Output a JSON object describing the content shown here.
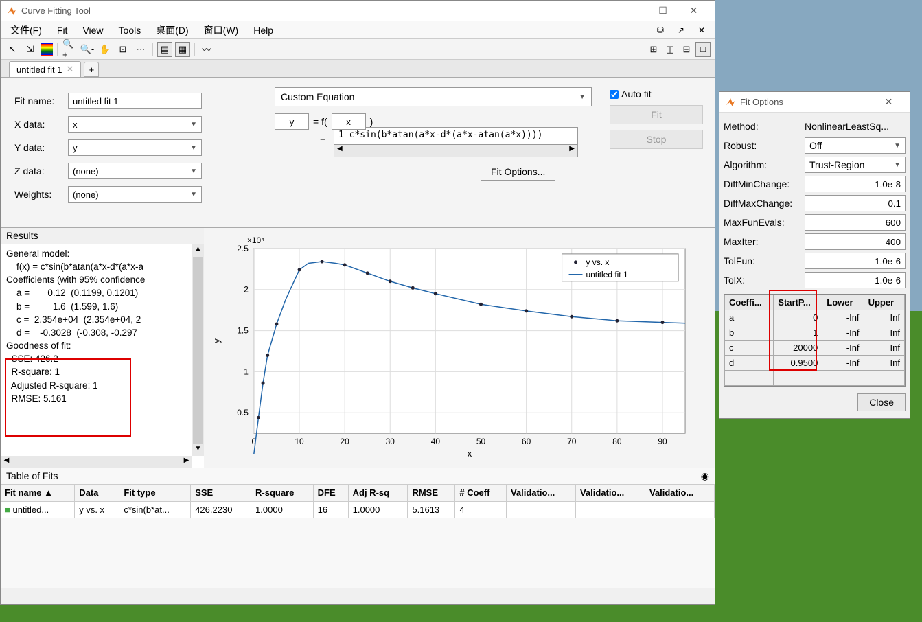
{
  "window": {
    "title": "Curve Fitting Tool"
  },
  "menu": {
    "file": "文件(F)",
    "fit": "Fit",
    "view": "View",
    "tools": "Tools",
    "desktop": "桌面(D)",
    "window": "窗口(W)",
    "help": "Help"
  },
  "tab": {
    "name": "untitled fit 1"
  },
  "config": {
    "fitname_label": "Fit name:",
    "fitname_value": "untitled fit 1",
    "xdata_label": "X data:",
    "xdata_value": "x",
    "ydata_label": "Y data:",
    "ydata_value": "y",
    "zdata_label": "Z data:",
    "zdata_value": "(none)",
    "weights_label": "Weights:",
    "weights_value": "(none)",
    "eqtype": "Custom Equation",
    "y_var": "y",
    "x_var": "x",
    "f_open": " = f( ",
    "f_close": " )",
    "eq_prefix": "=",
    "equation": "1 c*sin(b*atan(a*x-d*(a*x-atan(a*x))))",
    "fit_options_btn": "Fit Options...",
    "autofit": "Auto fit",
    "fit_btn": "Fit",
    "stop_btn": "Stop"
  },
  "results": {
    "header": "Results",
    "l1": "General model:",
    "l2": "    f(x) = c*sin(b*atan(a*x-d*(a*x-a",
    "l3": "Coefficients (with 95% confidence",
    "l4": "    a =       0.12  (0.1199, 0.1201)",
    "l5": "    b =         1.6  (1.599, 1.6)",
    "l6": "    c =  2.354e+04  (2.354e+04, 2",
    "l7": "    d =    -0.3028  (-0.308, -0.297",
    "l8": "",
    "g1": "Goodness of fit:",
    "g2": "  SSE: 426.2",
    "g3": "  R-square: 1",
    "g4": "  Adjusted R-square: 1",
    "g5": "  RMSE: 5.161"
  },
  "chart_data": {
    "type": "line",
    "xlabel": "x",
    "ylabel": "y",
    "exponent": "×10⁴",
    "xlim": [
      0,
      95
    ],
    "ylim": [
      0.25,
      2.5
    ],
    "legend": {
      "points": "y vs. x",
      "fit": "untitled fit 1"
    },
    "points_x": [
      1,
      2,
      3,
      5,
      10,
      15,
      20,
      25,
      30,
      35,
      40,
      50,
      60,
      70,
      80,
      90
    ],
    "points_y": [
      0.44,
      0.86,
      1.2,
      1.58,
      2.24,
      2.34,
      2.3,
      2.2,
      2.1,
      2.02,
      1.95,
      1.82,
      1.74,
      1.67,
      1.62,
      1.6
    ],
    "fit_curve_x": [
      0,
      1,
      2,
      3,
      5,
      7,
      10,
      12,
      15,
      18,
      20,
      25,
      30,
      35,
      40,
      50,
      60,
      70,
      80,
      90,
      95
    ],
    "fit_curve_y": [
      0.0,
      0.44,
      0.86,
      1.2,
      1.58,
      1.88,
      2.24,
      2.32,
      2.34,
      2.32,
      2.3,
      2.2,
      2.1,
      2.02,
      1.95,
      1.82,
      1.74,
      1.67,
      1.62,
      1.6,
      1.59
    ]
  },
  "fits_table": {
    "header": "Table of Fits",
    "cols": [
      "Fit name ▲",
      "Data",
      "Fit type",
      "SSE",
      "R-square",
      "DFE",
      "Adj R-sq",
      "RMSE",
      "# Coeff",
      "Validatio...",
      "Validatio...",
      "Validatio..."
    ],
    "row": [
      "untitled...",
      "y vs. x",
      "c*sin(b*at...",
      "426.2230",
      "1.0000",
      "16",
      "1.0000",
      "5.1613",
      "4",
      "",
      "",
      ""
    ]
  },
  "fitopts": {
    "title": "Fit Options",
    "method_l": "Method:",
    "method_v": "NonlinearLeastSq...",
    "robust_l": "Robust:",
    "robust_v": "Off",
    "algo_l": "Algorithm:",
    "algo_v": "Trust-Region",
    "dminc_l": "DiffMinChange:",
    "dminc_v": "1.0e-8",
    "dmaxc_l": "DiffMaxChange:",
    "dmaxc_v": "0.1",
    "maxfun_l": "MaxFunEvals:",
    "maxfun_v": "600",
    "maxiter_l": "MaxIter:",
    "maxiter_v": "400",
    "tolfun_l": "TolFun:",
    "tolfun_v": "1.0e-6",
    "tolx_l": "TolX:",
    "tolx_v": "1.0e-6",
    "coef_cols": [
      "Coeffi...",
      "StartP...",
      "Lower",
      "Upper"
    ],
    "coef_rows": [
      [
        "a",
        "0",
        "-Inf",
        "Inf"
      ],
      [
        "b",
        "1",
        "-Inf",
        "Inf"
      ],
      [
        "c",
        "20000",
        "-Inf",
        "Inf"
      ],
      [
        "d",
        "0.9500",
        "-Inf",
        "Inf"
      ]
    ],
    "close": "Close"
  }
}
